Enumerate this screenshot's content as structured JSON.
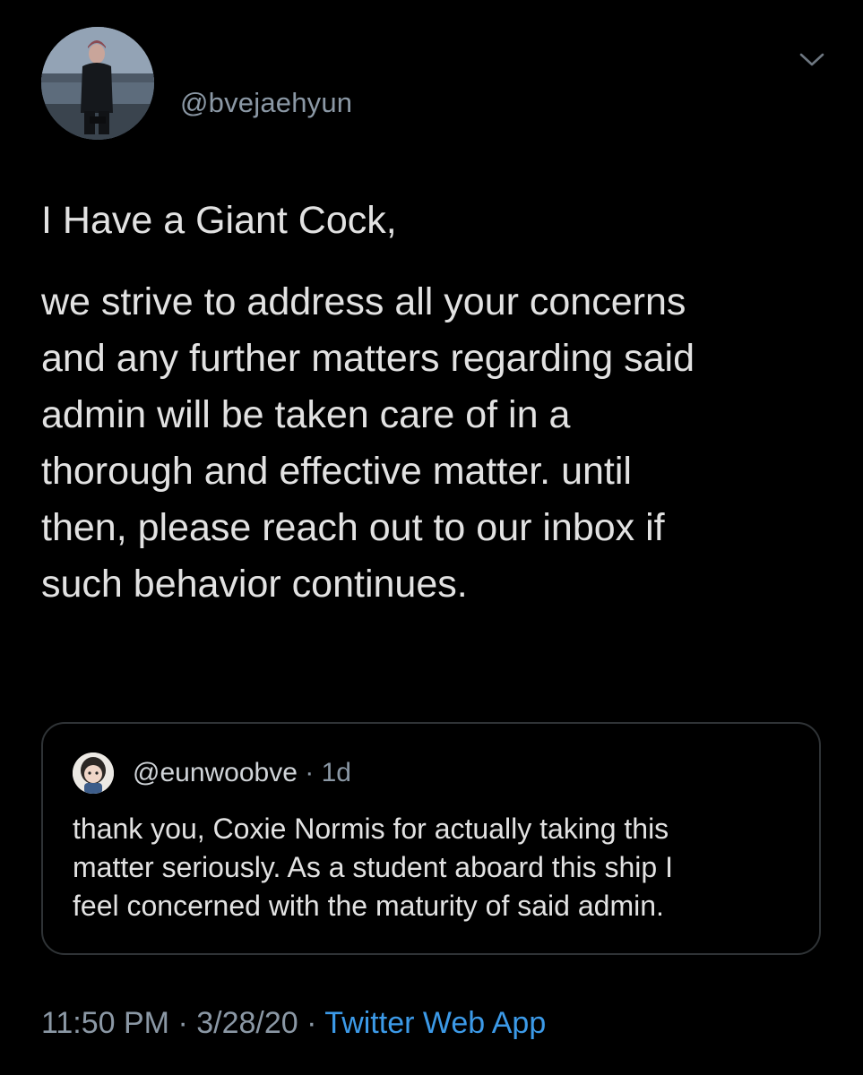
{
  "author": {
    "handle": "@bvejaehyun",
    "avatar_icon": "profile-photo"
  },
  "menu": {
    "icon": "chevron-down-icon"
  },
  "tweet": {
    "first_line": "I Have a Giant Cock,",
    "body": "we strive to address all your concerns\nand any further matters regarding said\nadmin will be taken care of in a\nthorough and effective matter. until\nthen, please reach out to our inbox if\nsuch behavior continues."
  },
  "quote": {
    "handle": "@eunwoobve",
    "separator": " · ",
    "age": "1d",
    "avatar_icon": "profile-photo",
    "body": "thank you, Coxie Normis for actually taking this\nmatter seriously. As a student aboard this ship I\nfeel concerned with the maturity of said admin."
  },
  "meta": {
    "time": "11:50 PM",
    "sep1": " · ",
    "date": "3/28/20",
    "sep2": " · ",
    "source": "Twitter Web App"
  },
  "colors": {
    "background": "#000000",
    "secondary_text": "#8b98a5",
    "link": "#3c9ae8",
    "border": "#2f3336"
  }
}
